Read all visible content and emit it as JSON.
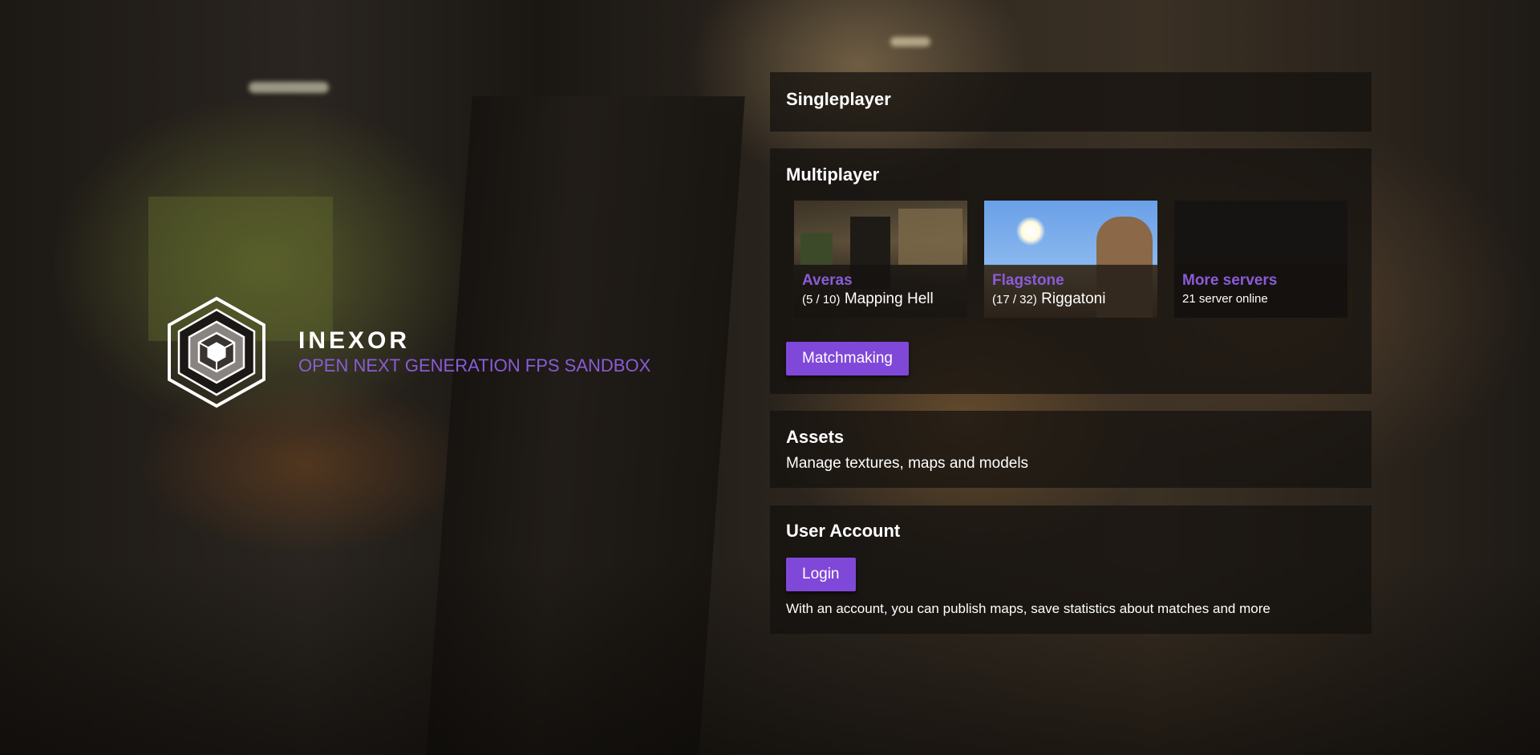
{
  "branding": {
    "title": "INEXOR",
    "subtitle": "OPEN NEXT GENERATION FPS SANDBOX",
    "accent_color": "#8a5cd8",
    "logo_icon": "hexagon-cube-icon"
  },
  "singleplayer": {
    "title": "Singleplayer"
  },
  "multiplayer": {
    "title": "Multiplayer",
    "servers": [
      {
        "name": "Averas",
        "players": "(5 / 10)",
        "map": "Mapping Hell"
      },
      {
        "name": "Flagstone",
        "players": "(17 / 32)",
        "map": "Riggatoni"
      }
    ],
    "more": {
      "name": "More servers",
      "info": "21 server online"
    },
    "matchmaking_label": "Matchmaking"
  },
  "assets": {
    "title": "Assets",
    "description": "Manage textures, maps and models"
  },
  "account": {
    "title": "User Account",
    "login_label": "Login",
    "description": "With an account, you can publish maps, save statistics about matches and more"
  },
  "colors": {
    "button": "#8048d8",
    "panel": "rgba(20,16,14,0.72)"
  }
}
